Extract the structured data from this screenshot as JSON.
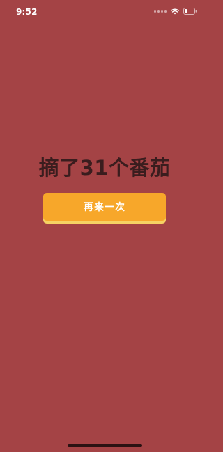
{
  "status_bar": {
    "time": "9:52",
    "signal_icon": "signal-dots-icon",
    "wifi_icon": "wifi-icon",
    "battery_icon": "battery-icon",
    "battery_level": 0.25
  },
  "main": {
    "result_text": "摘了31个番茄",
    "retry_label": "再来一次"
  },
  "colors": {
    "background": "#A44345",
    "title": "#3A1D1E",
    "button": "#F7A72A",
    "button_shadow": "#F6D264"
  }
}
